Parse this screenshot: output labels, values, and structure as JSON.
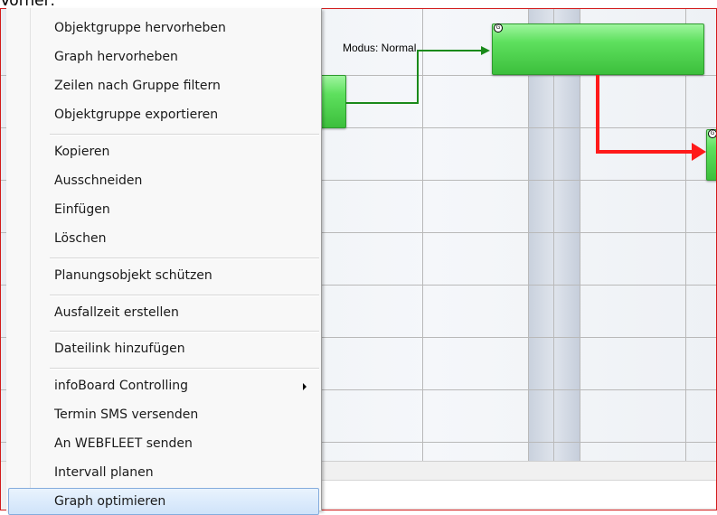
{
  "header_text": "Vorher:",
  "status_bar": {
    "mode": "Modus: Normal"
  },
  "context_menu": {
    "items": [
      {
        "label": "Objektgruppe hervorheben"
      },
      {
        "label": "Graph hervorheben"
      },
      {
        "label": "Zeilen nach Gruppe filtern"
      },
      {
        "label": "Objektgruppe exportieren"
      },
      {
        "label": "Kopieren"
      },
      {
        "label": "Ausschneiden"
      },
      {
        "label": "Einfügen"
      },
      {
        "label": "Löschen"
      },
      {
        "label": "Planungsobjekt schützen"
      },
      {
        "label": "Ausfallzeit erstellen"
      },
      {
        "label": "Dateilink hinzufügen"
      },
      {
        "label": "infoBoard Controlling",
        "has_submenu": true
      },
      {
        "label": "Termin SMS versenden"
      },
      {
        "label": "An WEBFLEET senden"
      },
      {
        "label": "Intervall planen"
      },
      {
        "label": "Graph optimieren",
        "highlighted": true
      }
    ]
  },
  "gantt": {
    "link_colors": {
      "normal": "#1a8a1a",
      "critical": "#ff1a1a"
    },
    "bar_marker_text": "G"
  }
}
